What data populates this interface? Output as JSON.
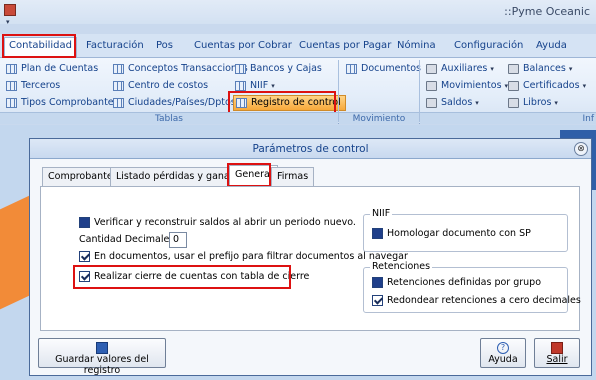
{
  "app": {
    "title": "::Pyme Oceanic",
    "qat_caret": "▾"
  },
  "tabs": [
    "Contabilidad",
    "Facturación",
    "Pos",
    "Cuentas por Cobrar",
    "Cuentas por Pagar",
    "Nómina",
    "Configuración",
    "Ayuda"
  ],
  "ribbon": {
    "tablas_col1": [
      "Plan de Cuentas",
      "Terceros",
      "Tipos Comprobantes"
    ],
    "tablas_col2": [
      "Conceptos Transacciones",
      "Centro de costos",
      "Ciudades/Países/Dptos"
    ],
    "tablas_col3": [
      "Bancos y Cajas",
      "NIIF",
      "Registro de control"
    ],
    "group_tablas": "Tablas",
    "movimiento_item": "Documentos",
    "group_movimiento": "Movimiento",
    "inf_col1": [
      "Auxiliares",
      "Movimientos",
      "Saldos"
    ],
    "inf_col2": [
      "Balances",
      "Certificados",
      "Libros"
    ],
    "group_inf": "Inf"
  },
  "dialog": {
    "title": "Parámetros de control",
    "close_glyph": "⊗",
    "tabs": [
      "Comprobantes",
      "Listado pérdidas y ganancias",
      "General",
      "Firmas"
    ],
    "checks": {
      "verify": "Verificar y reconstruir saldos al abrir un periodo nuevo.",
      "prefix": "En documentos, usar el prefijo para filtrar documentos al navegar",
      "cierre": "Realizar cierre de cuentas con tabla de cierre"
    },
    "decimals_label": "Cantidad Decimales",
    "decimals_value": "0",
    "niif": {
      "legend": "NIIF",
      "homologar": "Homologar documento con SP"
    },
    "retenciones": {
      "legend": "Retenciones",
      "por_grupo": "Retenciones definidas por grupo",
      "redondear": "Redondear retenciones a cero decimales"
    },
    "buttons": {
      "save": "Guardar valores del registro",
      "help": "Ayuda",
      "exit": "Salir"
    }
  }
}
